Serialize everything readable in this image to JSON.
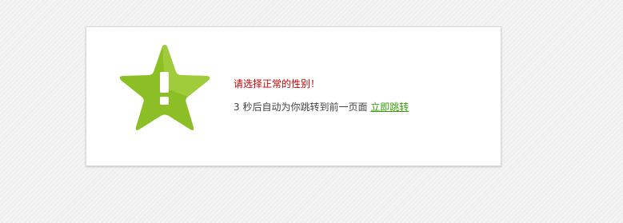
{
  "message": {
    "error_text": "请选择正常的性别！",
    "countdown_seconds": "3",
    "countdown_text": " 秒后自动为你跳转到前一页面 ",
    "redirect_link_label": "立即跳转"
  },
  "icon": {
    "name": "warning-star-icon",
    "color": "#8cbf26",
    "symbol": "!"
  },
  "colors": {
    "error": "#cc0000",
    "link": "#3a9a0a",
    "text": "#444444",
    "background": "#efefef",
    "panel": "#ffffff"
  }
}
